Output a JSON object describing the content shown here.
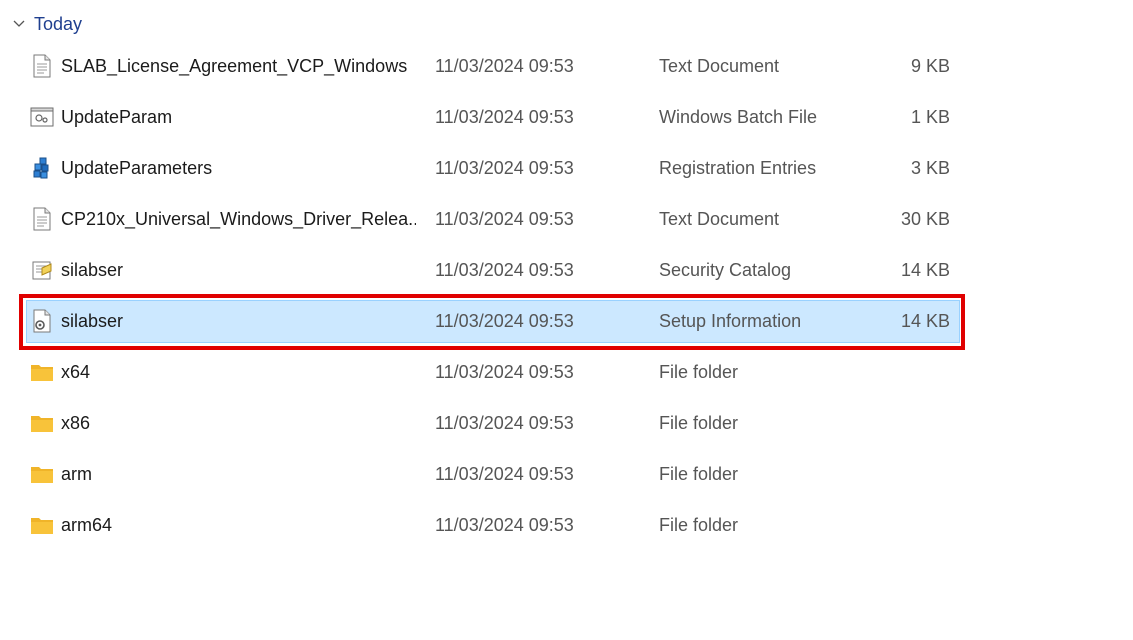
{
  "group": {
    "title": "Today",
    "chevron_icon": "chevron-down-icon"
  },
  "files": [
    {
      "name": "SLAB_License_Agreement_VCP_Windows",
      "modified": "11/03/2024 09:53",
      "type": "Text Document",
      "size": "9 KB",
      "icon": "text-document-icon"
    },
    {
      "name": "UpdateParam",
      "modified": "11/03/2024 09:53",
      "type": "Windows Batch File",
      "size": "1 KB",
      "icon": "batch-file-icon"
    },
    {
      "name": "UpdateParameters",
      "modified": "11/03/2024 09:53",
      "type": "Registration Entries",
      "size": "3 KB",
      "icon": "registry-icon"
    },
    {
      "name": "CP210x_Universal_Windows_Driver_Relea...",
      "modified": "11/03/2024 09:53",
      "type": "Text Document",
      "size": "30 KB",
      "icon": "text-document-icon"
    },
    {
      "name": "silabser",
      "modified": "11/03/2024 09:53",
      "type": "Security Catalog",
      "size": "14 KB",
      "icon": "security-catalog-icon"
    },
    {
      "name": "silabser",
      "modified": "11/03/2024 09:53",
      "type": "Setup Information",
      "size": "14 KB",
      "icon": "setup-information-icon",
      "selected": true
    },
    {
      "name": "x64",
      "modified": "11/03/2024 09:53",
      "type": "File folder",
      "size": "",
      "icon": "folder-icon"
    },
    {
      "name": "x86",
      "modified": "11/03/2024 09:53",
      "type": "File folder",
      "size": "",
      "icon": "folder-icon"
    },
    {
      "name": "arm",
      "modified": "11/03/2024 09:53",
      "type": "File folder",
      "size": "",
      "icon": "folder-icon"
    },
    {
      "name": "arm64",
      "modified": "11/03/2024 09:53",
      "type": "File folder",
      "size": "",
      "icon": "folder-icon"
    }
  ],
  "colors": {
    "selection_bg": "#cce8ff",
    "selection_border": "#99d1ff",
    "highlight": "#e00000",
    "folder": "#f8c33a"
  }
}
